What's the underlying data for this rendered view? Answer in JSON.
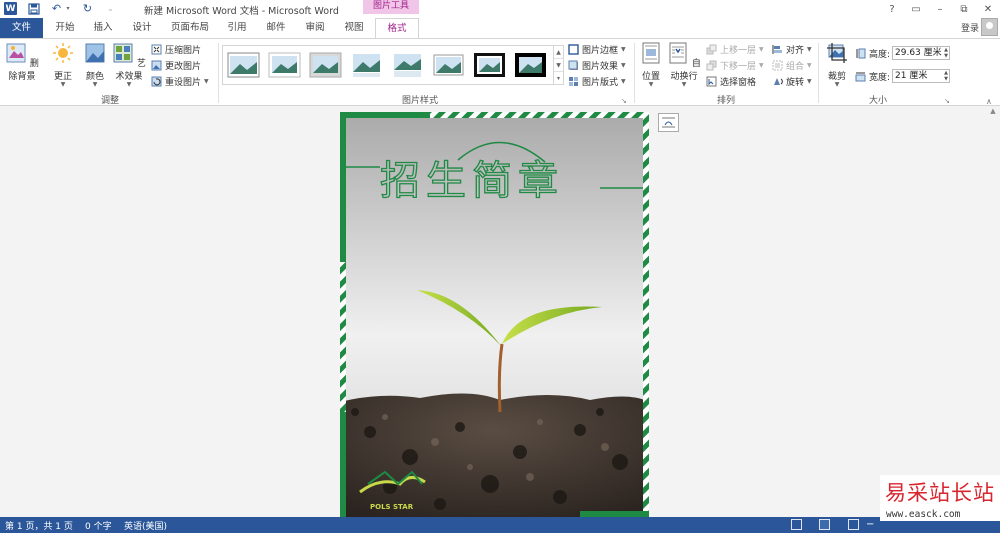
{
  "window": {
    "title": "新建 Microsoft Word 文档 - Microsoft Word",
    "context_group": "图片工具",
    "controls": [
      "?",
      "▭",
      "–",
      "⧉",
      "✕"
    ],
    "login": "登录",
    "word_logo": "W"
  },
  "tabs": [
    {
      "label": "文件"
    },
    {
      "label": "开始"
    },
    {
      "label": "插入"
    },
    {
      "label": "设计"
    },
    {
      "label": "页面布局"
    },
    {
      "label": "引用"
    },
    {
      "label": "邮件"
    },
    {
      "label": "审阅"
    },
    {
      "label": "视图"
    },
    {
      "label": "格式"
    }
  ],
  "ribbon": {
    "adjust": {
      "label": "调整",
      "remove_bg": "删除背景",
      "corrections": "更正",
      "color": "颜色",
      "artistic": "艺术效果",
      "compress": "压缩图片",
      "change": "更改图片",
      "reset": "重设图片"
    },
    "styles": {
      "label": "图片样式",
      "border": "图片边框",
      "effects": "图片效果",
      "layout": "图片版式",
      "scroll": [
        "▲",
        "▼",
        "▾"
      ]
    },
    "arrange": {
      "label": "排列",
      "position": "位置",
      "wrap": "自动换行",
      "bring_forward": "上移一层",
      "send_backward": "下移一层",
      "selection_pane": "选择窗格",
      "align": "对齐",
      "group": "组合",
      "rotate": "旋转"
    },
    "size": {
      "label": "大小",
      "crop": "裁剪",
      "height_label": "高度:",
      "height_value": "29.63 厘米",
      "width_label": "宽度:",
      "width_value": "21 厘米"
    }
  },
  "poster": {
    "title": "招生简章",
    "logo_text": "POLS STAR"
  },
  "statusbar": {
    "page": "第 1 页，共 1 页",
    "words": "0 个字",
    "language": "英语(美国)"
  },
  "watermark": {
    "title": "易采站长站",
    "url": "www.easck.com"
  },
  "colors": {
    "word_blue": "#2b579a",
    "context_pink": "#a3238c",
    "poster_green": "#1e8a44",
    "watermark_red": "#d8262f"
  }
}
